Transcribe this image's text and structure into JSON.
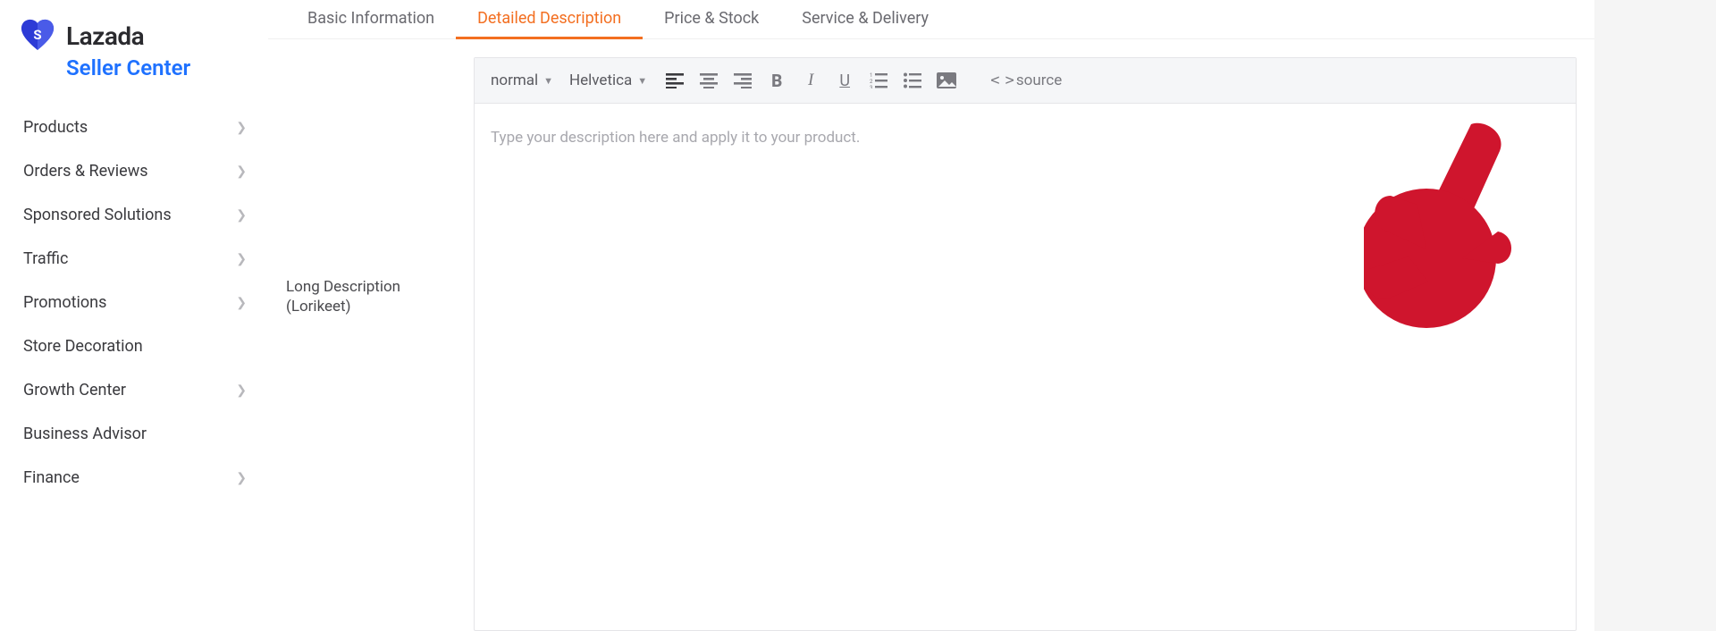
{
  "brand": {
    "name": "Lazada",
    "sub": "Seller Center"
  },
  "sidebar": {
    "items": [
      {
        "label": "Products",
        "expandable": true
      },
      {
        "label": "Orders & Reviews",
        "expandable": true
      },
      {
        "label": "Sponsored Solutions",
        "expandable": true
      },
      {
        "label": "Traffic",
        "expandable": true
      },
      {
        "label": "Promotions",
        "expandable": true
      },
      {
        "label": "Store Decoration",
        "expandable": false
      },
      {
        "label": "Growth Center",
        "expandable": true
      },
      {
        "label": "Business Advisor",
        "expandable": false
      },
      {
        "label": "Finance",
        "expandable": true
      }
    ]
  },
  "tabs": [
    {
      "label": "Basic Information",
      "active": false
    },
    {
      "label": "Detailed Description",
      "active": true
    },
    {
      "label": "Price & Stock",
      "active": false
    },
    {
      "label": "Service & Delivery",
      "active": false
    }
  ],
  "field": {
    "label_line1": "Long Description",
    "label_line2": "(Lorikeet)"
  },
  "toolbar": {
    "format": "normal",
    "font": "Helvetica",
    "source": "source"
  },
  "editor": {
    "placeholder": "Type your description here and apply it to your product."
  }
}
